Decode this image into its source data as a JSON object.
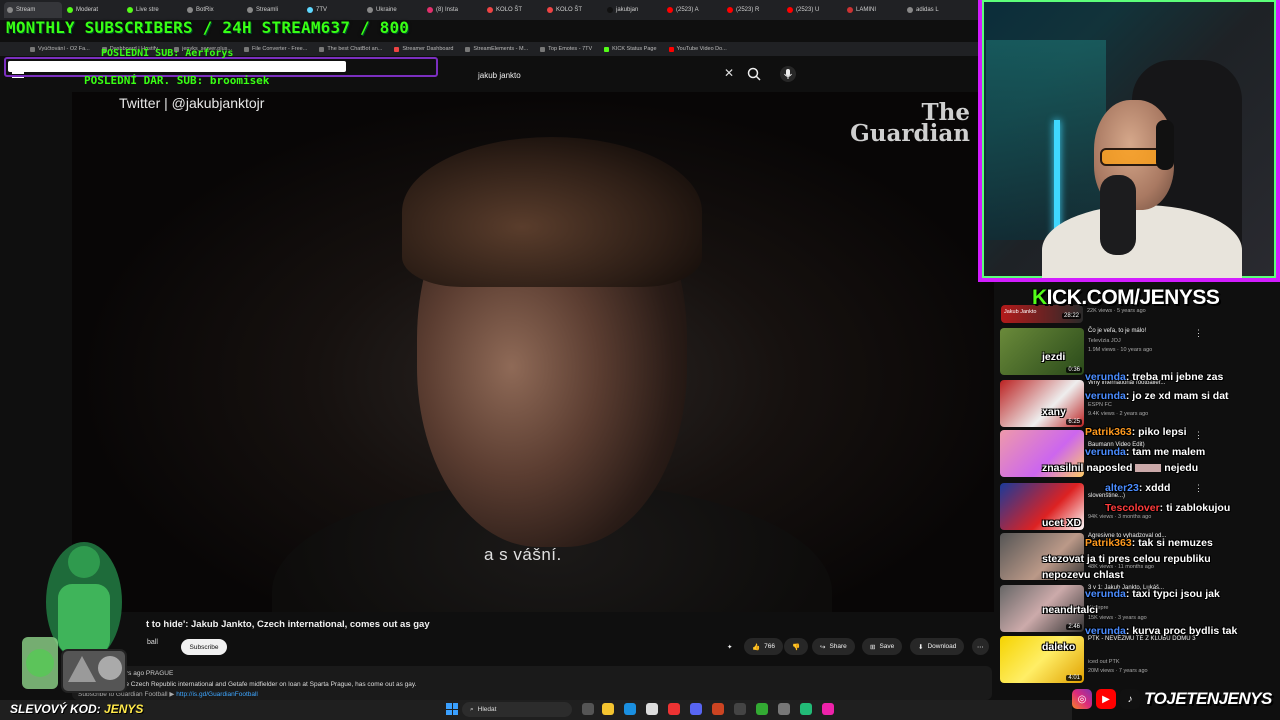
{
  "browser": {
    "tabs": [
      "Stream",
      "Moderat",
      "Live stre",
      "BotRix",
      "Streamli",
      "7TV",
      "Ukraine",
      "(8) Insta",
      "KOLO ŠT",
      "KOLO ŠT",
      "jakubjan",
      "(2523) A",
      "(2523) R",
      "(2523) U",
      "LAMINI",
      "adidas L"
    ],
    "bookmarks": [
      "Vyúčtování - O2 Fa...",
      "Dashboard | Hostify...",
      "jenyks_server.plus...",
      "File Converter - Free...",
      "The best ChatBot an...",
      "Streamer Dashboard",
      "StreamElements - M...",
      "Top Emotes - 7TV",
      "KICK Status Page",
      "YouTube Video Do..."
    ]
  },
  "overlay": {
    "subscribers_banner": "MONTHLY SUBSCRIBERS / 24H STREAM637 / 800",
    "last_sub": "POSLEDNÍ SUB: Aerforys",
    "last_donation": "POSLEDNÍ DAR. SUB: broomisek",
    "kick_banner_prefix": "K",
    "kick_banner_rest": "ICK.COM/JENYSS",
    "social_handle": "TOJETENJENYS",
    "sale_code_label": "SLEVOVÝ KOD: ",
    "sale_code_value": "JENYS"
  },
  "youtube": {
    "search_value": "jakub jankto",
    "video": {
      "twitter_handle": "Twitter | @jakubjanktojr",
      "logo_line1": "The",
      "logo_line2": "Guardian",
      "subtitle": "a s vášní.",
      "title": "t to hide': Jakub Jankto, Czech international, comes out as gay",
      "channel": "ball",
      "subscribe": "Subscribe",
      "like_count": "766",
      "share": "Share",
      "save": "Save",
      "download": "Download",
      "desc_meta": "rs ago  PRAGUE",
      "desc_line1": "Jakub Jankto, the Czech Republic international and Getafe midfielder on loan at Sparta Prague, has come out as gay.",
      "desc_line2": "Subscribe to Guardian Football ▶ ",
      "desc_link": "http://is.gd/GuardianFootball"
    },
    "top_suggestion": {
      "label": "Jakub Jankto",
      "duration": "28:22",
      "meta": "22K views · 5 years ago"
    },
    "suggestions": [
      {
        "title": "Čo je veľa, to je málo!",
        "channel": "Televízia JOJ",
        "views": "1.9M views · 10 years ago",
        "duration": "0:36"
      },
      {
        "title": "Why international footballer...",
        "channel": "ESPN FC",
        "views": "9.4K views · 2 years ago",
        "duration": "6:25"
      },
      {
        "title": "Baumann Video Edit)",
        "channel": "Baumann",
        "views": "",
        "duration": ""
      },
      {
        "title": "slovenštine...)",
        "channel": "",
        "views": "94K views · 3 months ago",
        "duration": ""
      },
      {
        "title": "Agresivne to vyhadzoval od...",
        "channel": "",
        "views": "48K views · 11 months ago",
        "duration": ""
      },
      {
        "title": "3 v 1: Jakub Jankto, Lukáš...",
        "channel": "Kicrepre",
        "views": "15K views · 3 years ago",
        "duration": "2:46"
      },
      {
        "title": "PTK - NEVĚZMU TĚ Z KLUBU DOMU 3",
        "channel": "iced out PTK",
        "views": "20M views · 7 years ago",
        "duration": "4:01"
      }
    ]
  },
  "chat": [
    {
      "user": "jezdi",
      "text": "",
      "user_color": "white"
    },
    {
      "user": "verunda",
      "text": ": treba mi jebne zas",
      "user_color": "blue"
    },
    {
      "user": "verunda",
      "text": ": jo ze xd mam si dat",
      "user_color": "blue"
    },
    {
      "user": "xany",
      "text": "",
      "user_color": "white"
    },
    {
      "user": "Patrik363",
      "text": ": piko lepsi",
      "user_color": "orange"
    },
    {
      "user": "verunda",
      "text": ": tam me malem",
      "user_color": "blue"
    },
    {
      "user": "znasilnil naposled",
      "text": "nejedu",
      "user_color": "white"
    },
    {
      "user": "alter23",
      "text": ": xddd",
      "user_color": "blue"
    },
    {
      "user": "Tescolover",
      "text": ": ti zablokujou",
      "user_color": "red"
    },
    {
      "user": "ucet XD",
      "text": "",
      "user_color": "white"
    },
    {
      "user": "Patrik363",
      "text": ": tak si nemuzes",
      "user_color": "orange"
    },
    {
      "user": "stezovat ja ti pres celou republiku",
      "text": "",
      "user_color": "white"
    },
    {
      "user": "nepozevu chlast",
      "text": "",
      "user_color": "white"
    },
    {
      "user": "verunda",
      "text": ": taxi typci jsou jak",
      "user_color": "blue"
    },
    {
      "user": "neandrtalci",
      "text": "",
      "user_color": "white"
    },
    {
      "user": "verunda",
      "text": ": kurva proc bydlis tak",
      "user_color": "blue"
    },
    {
      "user": "daleko",
      "text": "",
      "user_color": "white"
    }
  ],
  "taskbar": {
    "search_placeholder": "Hledat"
  },
  "colors": {
    "kick_green": "#53fc18",
    "neon_green": "#39ff14",
    "webcam_border": "#d21cff",
    "chat_blue": "#4a8cff",
    "chat_orange": "#ff9a1f"
  }
}
